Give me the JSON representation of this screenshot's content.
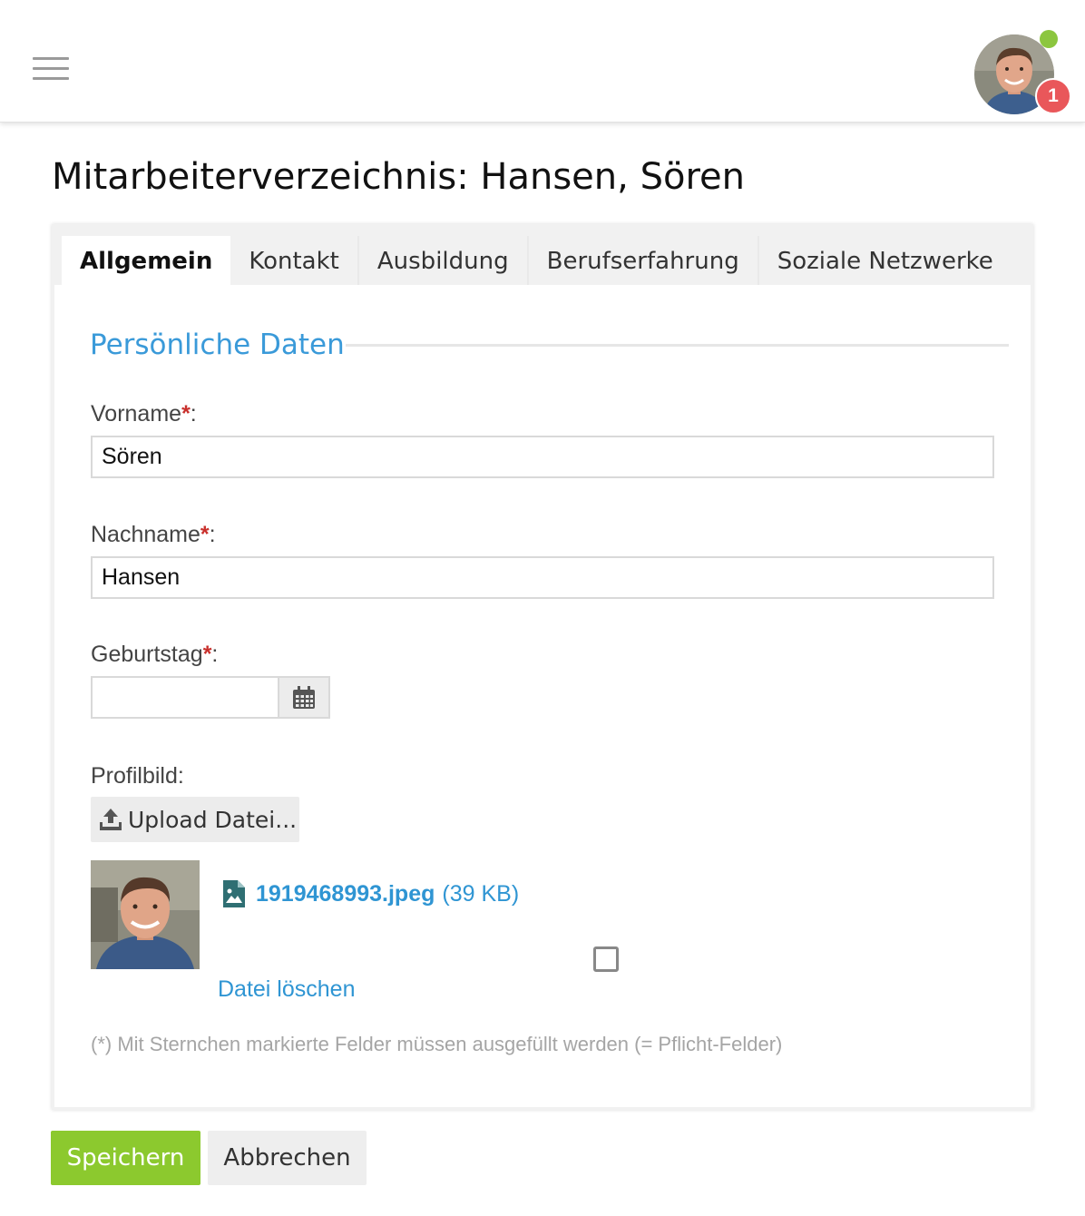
{
  "header": {
    "menu_icon": "hamburger-menu-icon",
    "avatar_icon": "user-avatar",
    "status_color": "#8cc63f",
    "notification_count": "1"
  },
  "page": {
    "title": "Mitarbeiterverzeichnis: Hansen, Sören"
  },
  "tabs": [
    {
      "label": "Allgemein",
      "active": true
    },
    {
      "label": "Kontakt"
    },
    {
      "label": "Ausbildung"
    },
    {
      "label": "Berufserfahrung"
    },
    {
      "label": "Soziale Netzwerke"
    }
  ],
  "section": {
    "title": "Persönliche Daten"
  },
  "form": {
    "firstname": {
      "label": "Vorname",
      "required_mark": "*",
      "suffix": ":",
      "value": "Sören"
    },
    "lastname": {
      "label": "Nachname",
      "required_mark": "*",
      "suffix": ":",
      "value": "Hansen"
    },
    "birthday": {
      "label": "Geburtstag",
      "required_mark": "*",
      "suffix": ":",
      "value": "",
      "button_icon": "calendar-icon"
    },
    "profile_image": {
      "label": "Profilbild:",
      "upload_label": "Upload Datei...",
      "upload_icon": "upload-icon",
      "file_icon": "image-file-icon",
      "file_name": "1919468993.jpeg",
      "file_size": "(39 KB)",
      "delete_label": "Datei löschen",
      "delete_checked": false
    },
    "required_note": "(*) Mit Sternchen markierte Felder müssen ausgefüllt werden (= Pflicht-Felder)"
  },
  "actions": {
    "save_label": "Speichern",
    "cancel_label": "Abbrechen"
  },
  "colors": {
    "accent_blue": "#3a9ad9",
    "save_green": "#8cc92e",
    "required_red": "#c9302c",
    "badge_red": "#e9575a"
  }
}
